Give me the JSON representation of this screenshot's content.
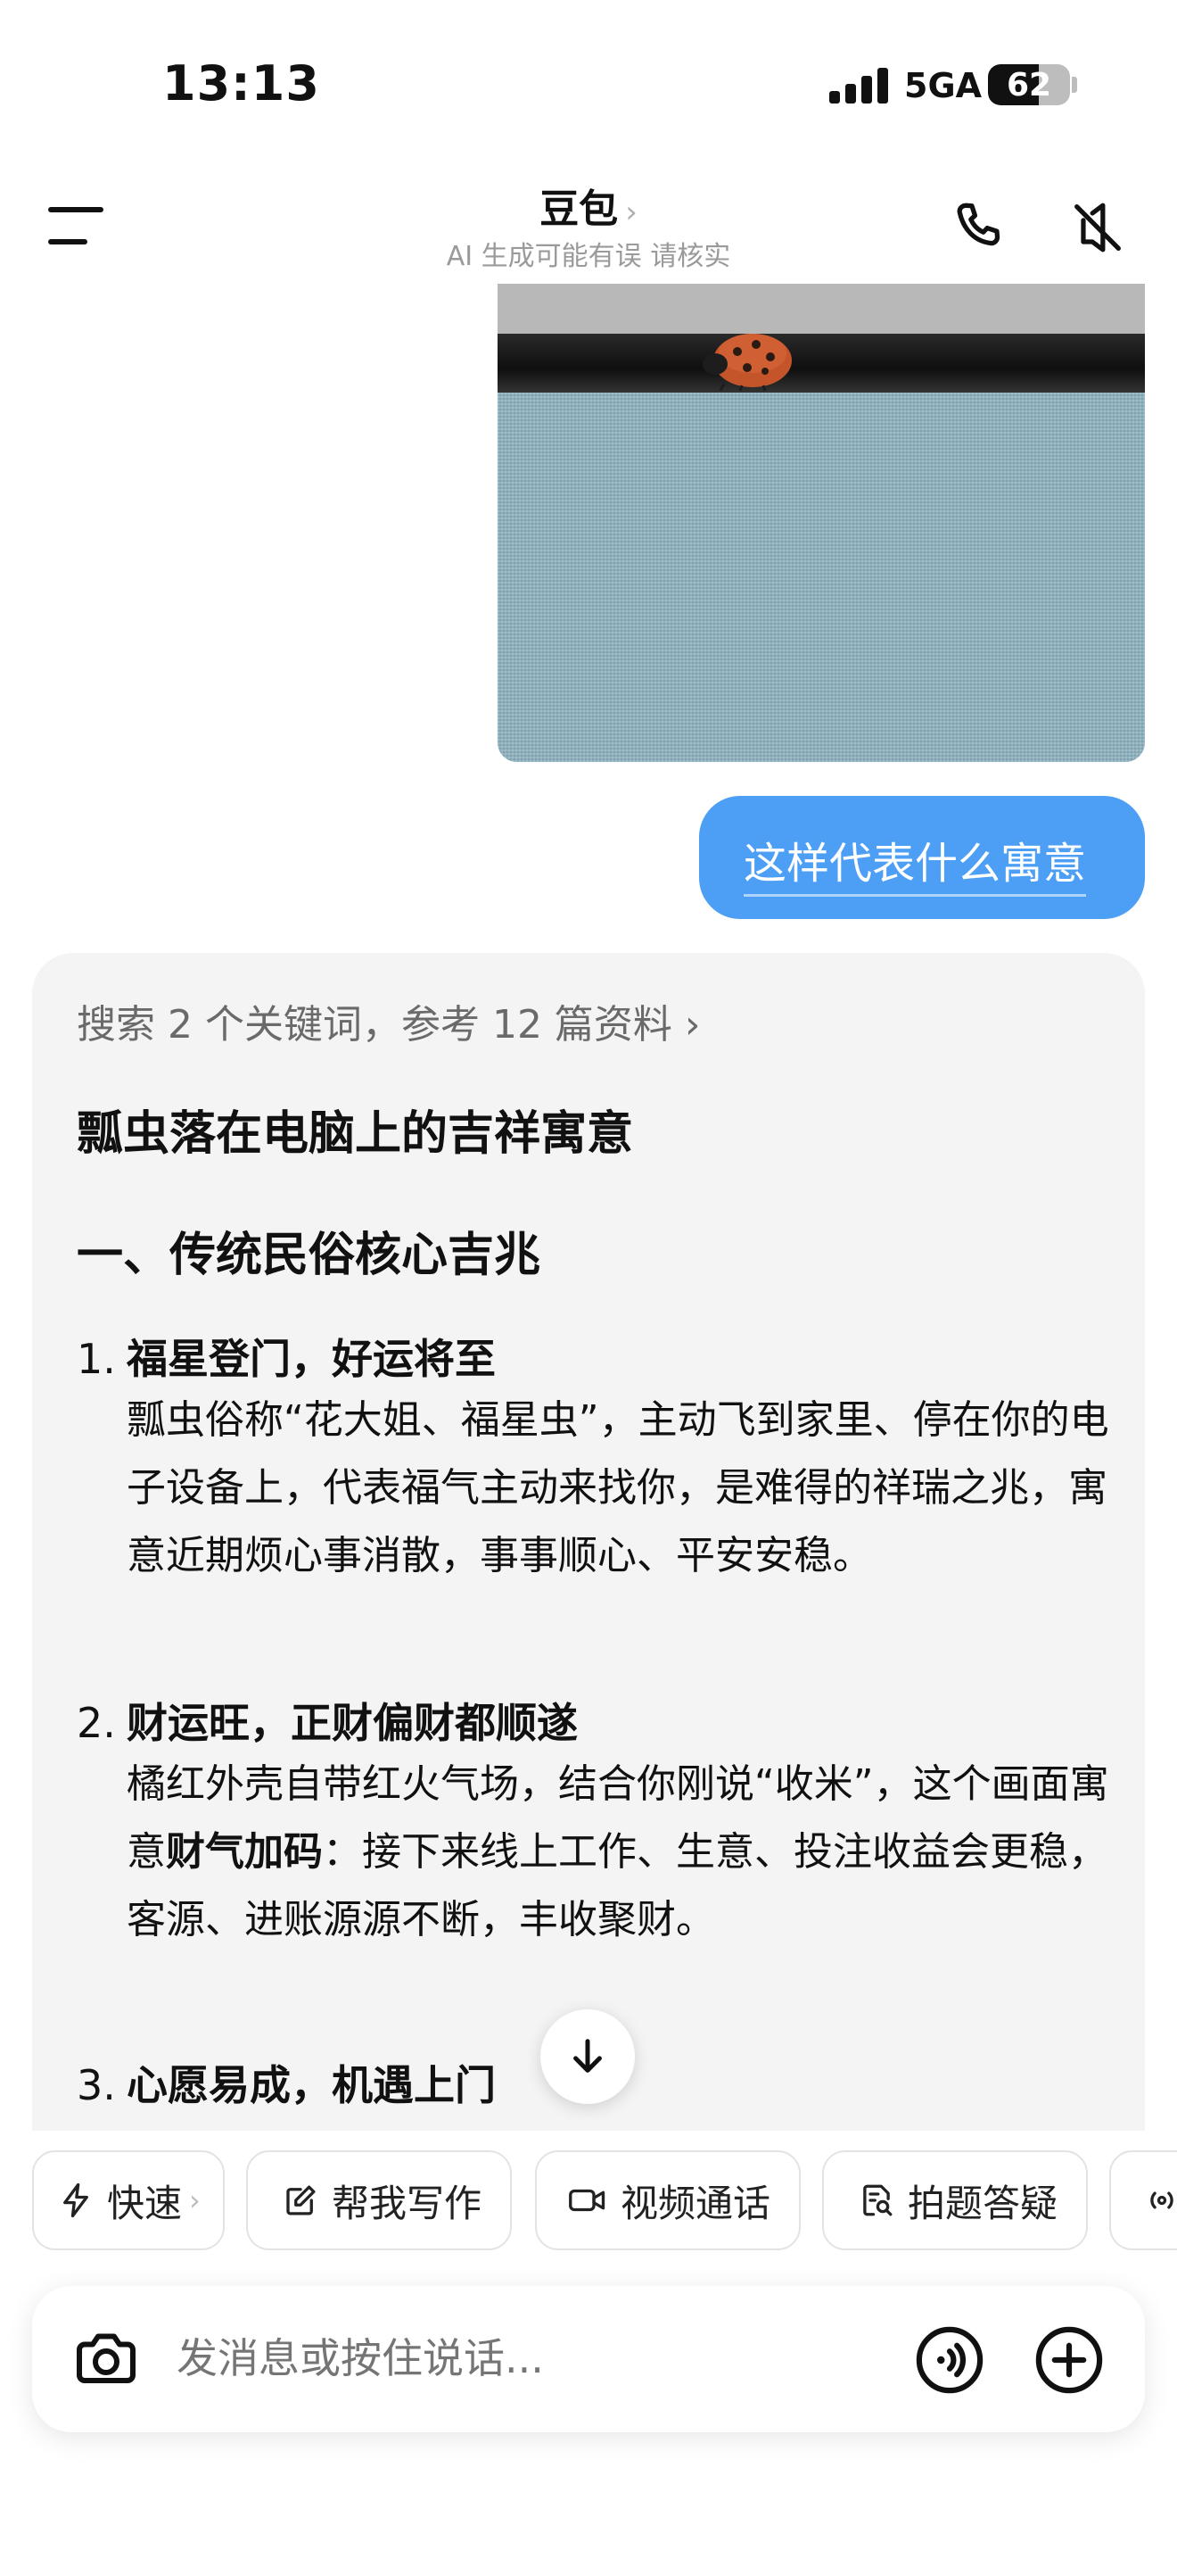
{
  "status_bar": {
    "time": "13:13",
    "network": "5GA",
    "battery": "62",
    "battery_level": 0.62
  },
  "header": {
    "title": "豆包",
    "subtitle": "AI 生成可能有误 请核实"
  },
  "messages": {
    "user_text": "这样代表什么寓意"
  },
  "answer": {
    "search_note": "搜索 2 个关键词，参考 12 篇资料 ›",
    "title": "瓢虫落在电脑上的吉祥寓意",
    "section_heading": "一、传统民俗核心吉兆",
    "items": [
      {
        "num": "1.",
        "heading": "福星登门，好运将至",
        "body": "瓢虫俗称“花大姐、福星虫”，主动飞到家里、停在你的电子设备上，代表福气主动来找你，是难得的祥瑞之兆，寓意近期烦心事消散，事事顺心、平安安稳。"
      },
      {
        "num": "2.",
        "heading": "财运旺，正财偏财都顺遂",
        "body_pre": "橘红外壳自带红火气场，结合你刚说“收米”，这个画面寓意",
        "body_bold": "财气加码",
        "body_post": "：接下来线上工作、生意、投注收益会更稳，客源、进账源源不断，丰收聚财。"
      },
      {
        "num": "3.",
        "heading": "心愿易成，机遇上门"
      }
    ]
  },
  "chips": [
    {
      "label": "快速",
      "suffix": "›",
      "icon": "lightning-icon"
    },
    {
      "label": "帮我写作",
      "icon": "edit-icon"
    },
    {
      "label": "视频通话",
      "icon": "video-icon"
    },
    {
      "label": "拍题答疑",
      "icon": "scan-doc-icon"
    }
  ],
  "input": {
    "placeholder": "发消息或按住说话..."
  },
  "colors": {
    "accent": "#4d9ff5",
    "card_bg": "#f4f4f5"
  }
}
